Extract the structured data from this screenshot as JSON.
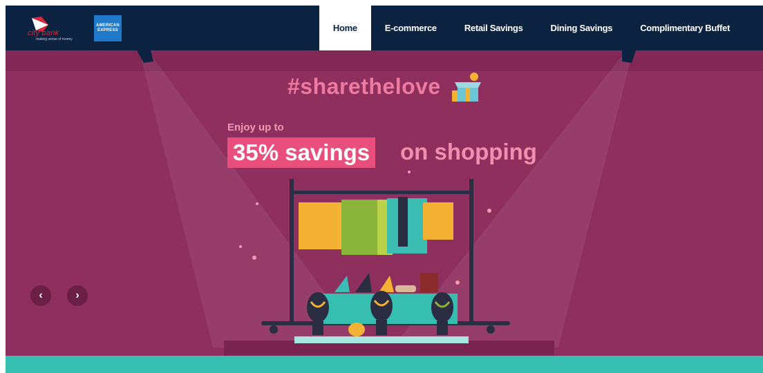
{
  "brand": {
    "city_bank_name": "city bank",
    "city_bank_tagline": "making sense of money",
    "amex_line1": "AMERICAN",
    "amex_line2": "EXPRESS"
  },
  "nav": {
    "items": [
      {
        "label": "Home",
        "active": true
      },
      {
        "label": "E-commerce",
        "active": false
      },
      {
        "label": "Retail Savings",
        "active": false
      },
      {
        "label": "Dining Savings",
        "active": false
      },
      {
        "label": "Complimentary Buffet",
        "active": false
      }
    ]
  },
  "hero": {
    "hashtag": "#sharethelove",
    "intro": "Enjoy up to",
    "highlight": "35% savings",
    "suffix": "on shopping",
    "prev_icon": "‹",
    "next_icon": "›"
  },
  "colors": {
    "nav_bg": "#0b2340",
    "hero_bg": "#8e2f5e",
    "accent_pink": "#e94f7c",
    "footer_teal": "#36bfb1"
  },
  "icons": [
    "city-bank-logo-icon",
    "american-express-logo-icon",
    "gift-box-icon",
    "chevron-left-icon",
    "chevron-right-icon"
  ]
}
